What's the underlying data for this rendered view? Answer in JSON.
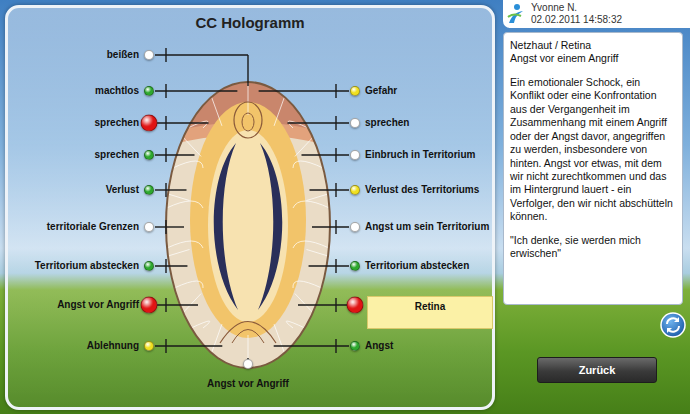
{
  "title": "CC Hologramm",
  "user": {
    "name": "Yvonne N.",
    "datetime": "02.02.2011 14:58:32"
  },
  "diagram": {
    "left": [
      {
        "label": "beißen",
        "color": "#ffffff",
        "highlighted": false
      },
      {
        "label": "machtlos",
        "color": "#2ea82e",
        "highlighted": false
      },
      {
        "label": "sprechen",
        "color": "#e01414",
        "highlighted": true
      },
      {
        "label": "sprechen",
        "color": "#2ea82e",
        "highlighted": false
      },
      {
        "label": "Verlust",
        "color": "#2ea82e",
        "highlighted": false
      },
      {
        "label": "territoriale Grenzen",
        "color": "#ffffff",
        "highlighted": false
      },
      {
        "label": "Territorium abstecken",
        "color": "#2ea82e",
        "highlighted": false
      },
      {
        "label": "Angst vor Angriff",
        "color": "#e01414",
        "highlighted": true
      },
      {
        "label": "Ablehnung",
        "color": "#f0e020",
        "highlighted": false
      }
    ],
    "right": [
      {
        "label": "Gefahr",
        "color": "#f0e020",
        "highlighted": false,
        "kind": "text"
      },
      {
        "label": "sprechen",
        "color": "#ffffff",
        "highlighted": false,
        "kind": "text"
      },
      {
        "label": "Einbruch in Territorium",
        "color": "#ffffff",
        "highlighted": false,
        "kind": "text"
      },
      {
        "label": "Verlust des Territoriums",
        "color": "#f0e020",
        "highlighted": false,
        "kind": "text"
      },
      {
        "label": "Angst um sein Territorium",
        "color": "#ffffff",
        "highlighted": false,
        "kind": "text"
      },
      {
        "label": "Territorium abstecken",
        "color": "#2ea82e",
        "highlighted": false,
        "kind": "text"
      },
      {
        "label": "Retina",
        "color": "#e01414",
        "highlighted": true,
        "kind": "box"
      },
      {
        "label": "Angst",
        "color": "#2ea82e",
        "highlighted": false,
        "kind": "text"
      }
    ],
    "bottom": {
      "label": "Angst vor Angriff",
      "color": "#ffffff",
      "highlighted": false
    }
  },
  "detail": {
    "title": "Netzhaut / Retina",
    "subtitle": "Angst vor einem Angriff",
    "text": "Ein emotionaler Schock, ein Konflikt oder eine Konfrontation aus der Vergangenheit im Zusammenhang mit einem Angriff oder der Angst davor, angegriffen zu werden, insbesondere von hinten. Angst vor etwas, mit dem wir nicht zurechtkommen und das im Hintergrund lauert - ein Verfolger, den wir nicht abschütteln können.",
    "quote": "\"Ich denke, sie werden mich erwischen\""
  },
  "buttons": {
    "back": "Zurück"
  }
}
